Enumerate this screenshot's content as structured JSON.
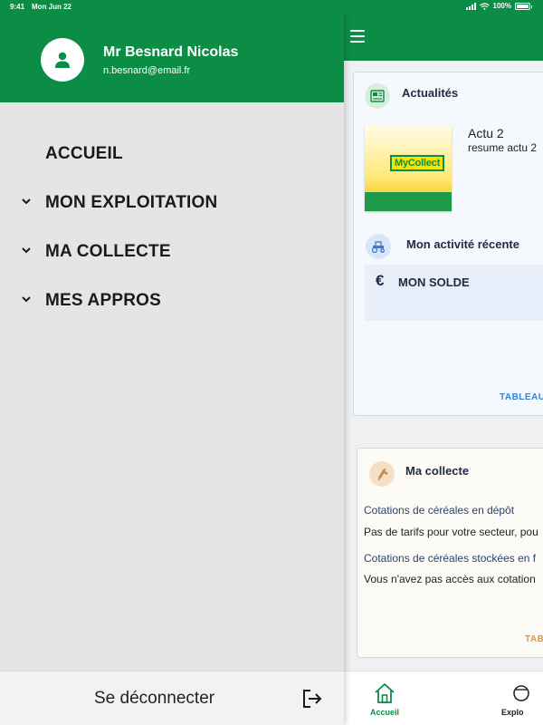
{
  "status_bar": {
    "time": "9:41",
    "date": "Mon Jun 22",
    "battery": "100%"
  },
  "drawer": {
    "user_name": "Mr Besnard Nicolas",
    "user_email": "n.besnard@email.fr",
    "menu": [
      {
        "label": "ACCUEIL",
        "expandable": false
      },
      {
        "label": "MON EXPLOITATION",
        "expandable": true
      },
      {
        "label": "MA COLLECTE",
        "expandable": true
      },
      {
        "label": "MES APPROS",
        "expandable": true
      }
    ],
    "logout_label": "Se déconnecter"
  },
  "main": {
    "news": {
      "title": "Actualités",
      "item_title": "Actu 2",
      "item_summary": "resume actu 2",
      "thumb_logo": "MyCollect"
    },
    "activity": {
      "title": "Mon activité récente",
      "solde_symbol": "€",
      "solde_label": "MON SOLDE",
      "link_label": "TABLEAU"
    },
    "collect": {
      "title": "Ma collecte",
      "quotes_deposit_label": "Cotations de céréales en dépôt",
      "quotes_deposit_text": "Pas de tarifs pour votre secteur, pou",
      "quotes_stored_label": "Cotations de céréales stockées en f",
      "quotes_stored_text": "Vous n'avez pas accès aux cotation",
      "link_label": "TAB"
    },
    "tabs": [
      {
        "label": "Accueil",
        "active": true
      },
      {
        "label": "Explo",
        "active": false
      }
    ]
  },
  "colors": {
    "brand_green": "#0b8d46",
    "link_blue": "#2f86d6",
    "link_orange": "#d9964f",
    "title_navy": "#1f2a44"
  }
}
